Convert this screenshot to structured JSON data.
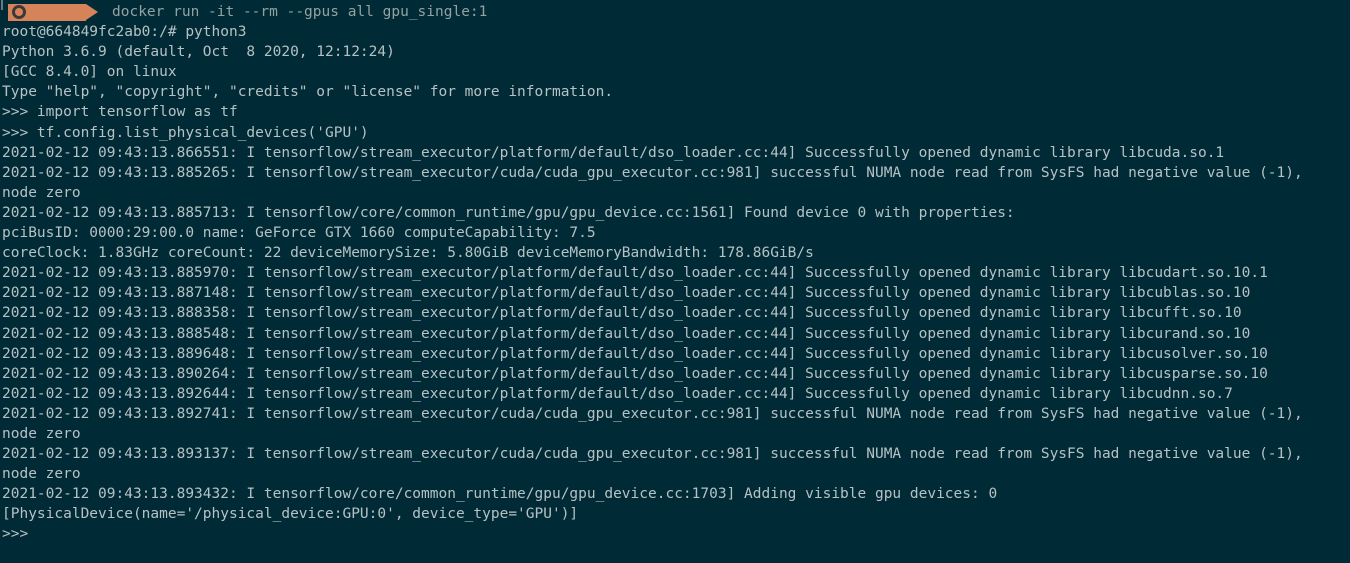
{
  "prompt": {
    "command": "docker run -it --rm --gpus all gpu_single:1"
  },
  "lines": [
    "root@664849fc2ab0:/# python3",
    "Python 3.6.9 (default, Oct  8 2020, 12:12:24)",
    "[GCC 8.4.0] on linux",
    "Type \"help\", \"copyright\", \"credits\" or \"license\" for more information.",
    ">>> import tensorflow as tf",
    ">>> tf.config.list_physical_devices('GPU')",
    "2021-02-12 09:43:13.866551: I tensorflow/stream_executor/platform/default/dso_loader.cc:44] Successfully opened dynamic library libcuda.so.1",
    "2021-02-12 09:43:13.885265: I tensorflow/stream_executor/cuda/cuda_gpu_executor.cc:981] successful NUMA node read from SysFS had negative value (-1),",
    "node zero",
    "2021-02-12 09:43:13.885713: I tensorflow/core/common_runtime/gpu/gpu_device.cc:1561] Found device 0 with properties:",
    "pciBusID: 0000:29:00.0 name: GeForce GTX 1660 computeCapability: 7.5",
    "coreClock: 1.83GHz coreCount: 22 deviceMemorySize: 5.80GiB deviceMemoryBandwidth: 178.86GiB/s",
    "2021-02-12 09:43:13.885970: I tensorflow/stream_executor/platform/default/dso_loader.cc:44] Successfully opened dynamic library libcudart.so.10.1",
    "2021-02-12 09:43:13.887148: I tensorflow/stream_executor/platform/default/dso_loader.cc:44] Successfully opened dynamic library libcublas.so.10",
    "2021-02-12 09:43:13.888358: I tensorflow/stream_executor/platform/default/dso_loader.cc:44] Successfully opened dynamic library libcufft.so.10",
    "2021-02-12 09:43:13.888548: I tensorflow/stream_executor/platform/default/dso_loader.cc:44] Successfully opened dynamic library libcurand.so.10",
    "2021-02-12 09:43:13.889648: I tensorflow/stream_executor/platform/default/dso_loader.cc:44] Successfully opened dynamic library libcusolver.so.10",
    "2021-02-12 09:43:13.890264: I tensorflow/stream_executor/platform/default/dso_loader.cc:44] Successfully opened dynamic library libcusparse.so.10",
    "2021-02-12 09:43:13.892644: I tensorflow/stream_executor/platform/default/dso_loader.cc:44] Successfully opened dynamic library libcudnn.so.7",
    "2021-02-12 09:43:13.892741: I tensorflow/stream_executor/cuda/cuda_gpu_executor.cc:981] successful NUMA node read from SysFS had negative value (-1),",
    "node zero",
    "2021-02-12 09:43:13.893137: I tensorflow/stream_executor/cuda/cuda_gpu_executor.cc:981] successful NUMA node read from SysFS had negative value (-1),",
    "node zero",
    "2021-02-12 09:43:13.893432: I tensorflow/core/common_runtime/gpu/gpu_device.cc:1703] Adding visible gpu devices: 0",
    "[PhysicalDevice(name='/physical_device:GPU:0', device_type='GPU')]",
    ">>>"
  ],
  "colors": {
    "background": "#002b36",
    "text": "#b6c1c4",
    "prompt_segment": "#d7835a"
  },
  "icons": {
    "prompt": "os-icon"
  }
}
